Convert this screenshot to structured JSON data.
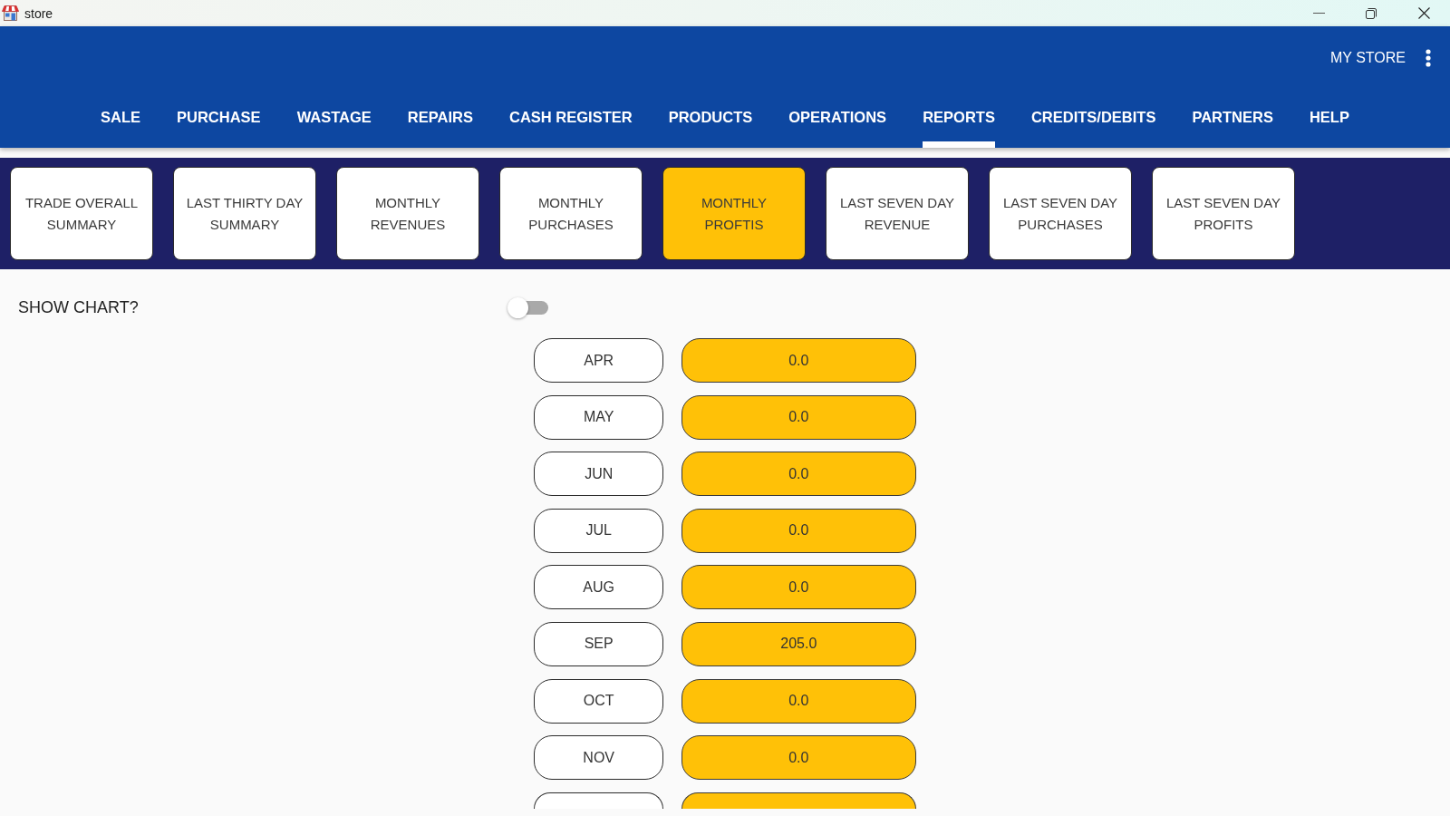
{
  "window": {
    "title": "store"
  },
  "header": {
    "store_name": "MY STORE",
    "nav_tabs": [
      {
        "label": "SALE",
        "selected": false
      },
      {
        "label": "PURCHASE",
        "selected": false
      },
      {
        "label": "WASTAGE",
        "selected": false
      },
      {
        "label": "REPAIRS",
        "selected": false
      },
      {
        "label": "CASH REGISTER",
        "selected": false
      },
      {
        "label": "PRODUCTS",
        "selected": false
      },
      {
        "label": "OPERATIONS",
        "selected": false
      },
      {
        "label": "REPORTS",
        "selected": true
      },
      {
        "label": "CREDITS/DEBITS",
        "selected": false
      },
      {
        "label": "PARTNERS",
        "selected": false
      },
      {
        "label": "HELP",
        "selected": false
      }
    ]
  },
  "report_tabs": [
    {
      "label": "TRADE OVERALL\nSUMMARY",
      "selected": false
    },
    {
      "label": "LAST THIRTY DAY\nSUMMARY",
      "selected": false
    },
    {
      "label": "MONTHLY\nREVENUES",
      "selected": false
    },
    {
      "label": "MONTHLY\nPURCHASES",
      "selected": false
    },
    {
      "label": "MONTHLY\nPROFTIS",
      "selected": true
    },
    {
      "label": "LAST SEVEN DAY\nREVENUE",
      "selected": false
    },
    {
      "label": "LAST SEVEN DAY\nPURCHASES",
      "selected": false
    },
    {
      "label": "LAST SEVEN DAY\nPROFITS",
      "selected": false
    }
  ],
  "show_chart": {
    "label": "SHOW CHART?",
    "on": false
  },
  "monthly_profits": {
    "rows": [
      {
        "month": "APR",
        "value": "0.0"
      },
      {
        "month": "MAY",
        "value": "0.0"
      },
      {
        "month": "JUN",
        "value": "0.0"
      },
      {
        "month": "JUL",
        "value": "0.0"
      },
      {
        "month": "AUG",
        "value": "0.0"
      },
      {
        "month": "SEP",
        "value": "205.0"
      },
      {
        "month": "OCT",
        "value": "0.0"
      },
      {
        "month": "NOV",
        "value": "0.0"
      }
    ],
    "partial_row_below": true
  }
}
